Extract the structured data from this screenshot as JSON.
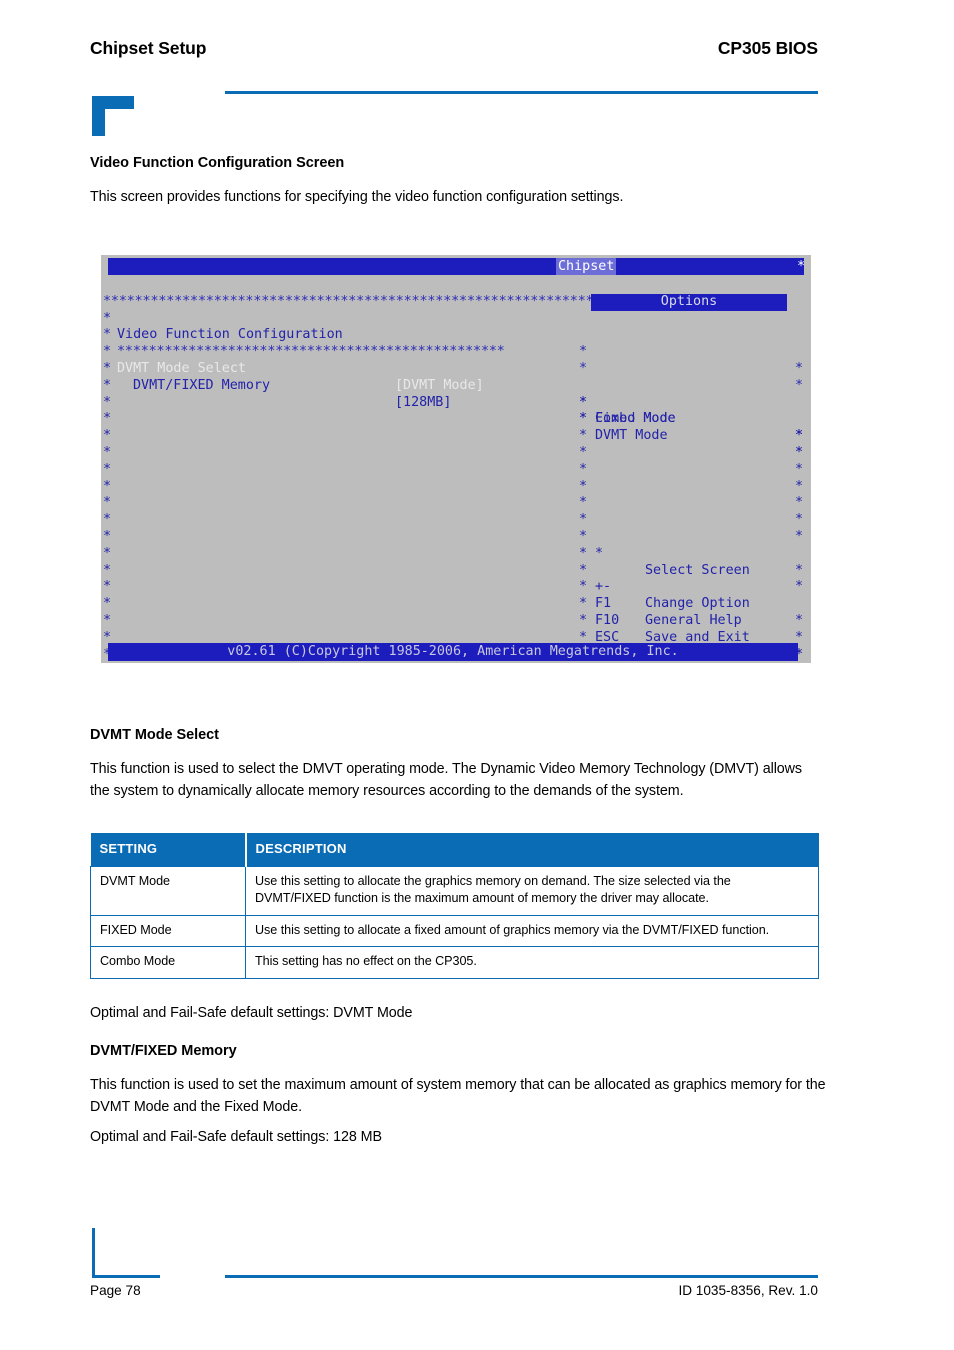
{
  "header": {
    "left_title": "Chipset Setup",
    "right_title": "CP305 BIOS"
  },
  "sections": {
    "video_function": {
      "heading": "Video Function Configuration Screen",
      "intro": "This screen provides functions for specifying the video function configuration settings."
    },
    "dvmt_mode_select": {
      "heading": "DVMT Mode Select",
      "description": "This function is used to select the DMVT operating mode. The Dynamic Video Memory Technology (DMVT) allows the system to dynamically allocate memory resources according to the demands of the system.",
      "default_note": "Optimal and Fail-Safe default settings: DVMT Mode"
    },
    "dvmt_fixed_memory": {
      "heading": "DVMT/FIXED Memory",
      "description": "This function is used to set the maximum amount of system memory that can be allocated as graphics memory for the DVMT Mode and the Fixed Mode.",
      "default_note": "Optimal and Fail-Safe default settings: 128 MB"
    }
  },
  "bios": {
    "title": "Chipset",
    "star_char": "*",
    "border_line": "***********************************************************************",
    "inner_separator": "*************************************************",
    "panel_heading": "Video Function Configuration",
    "options_header": "Options",
    "items": [
      {
        "label": "DVMT Mode Select",
        "value": "[DVMT Mode]",
        "selected": true,
        "indent": false
      },
      {
        "label": "DVMT/FIXED Memory",
        "value": "[128MB]",
        "selected": false,
        "indent": true
      }
    ],
    "options": [
      "Fixed Mode",
      "DVMT Mode",
      "Combo Mode"
    ],
    "help_keys": [
      {
        "key": "*",
        "desc": "Select Screen"
      },
      {
        "key": "+-",
        "desc": "Change Option"
      },
      {
        "key": "F1",
        "desc": "General Help"
      },
      {
        "key": "F10",
        "desc": "Save and Exit"
      },
      {
        "key": "ESC",
        "desc": "Exit"
      }
    ],
    "copyright": "v02.61 (C)Copyright 1985-2006, American Megatrends, Inc."
  },
  "table": {
    "columns": [
      "SETTING",
      "DESCRIPTION"
    ],
    "rows": [
      {
        "setting": "DVMT Mode",
        "description": "Use this setting to allocate the graphics memory on demand. The size selected via the DVMT/FIXED function is the maximum amount of memory the driver may allocate."
      },
      {
        "setting": "FIXED Mode",
        "description": "Use this setting to allocate a fixed amount of graphics memory via the DVMT/FIXED function."
      },
      {
        "setting": "Combo Mode",
        "description": "This setting has no effect on the CP305."
      }
    ]
  },
  "footer": {
    "page": "Page 78",
    "doc_id": "ID 1035-8356, Rev. 1.0"
  },
  "colors": {
    "accent": "#0A6CB5",
    "bios_background": "#bdbdbd",
    "bios_blue": "#1d1dbe",
    "bios_text": "#2222aa"
  }
}
